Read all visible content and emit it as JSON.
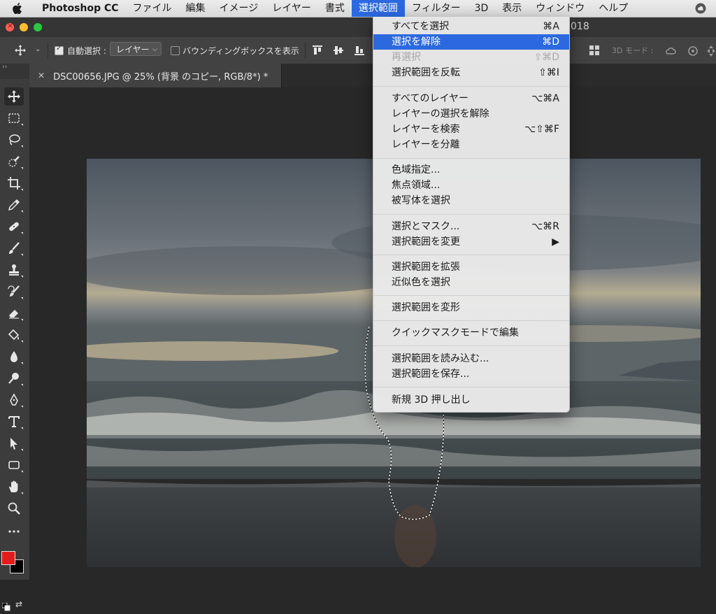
{
  "menubar": {
    "app_name": "Photoshop CC",
    "items": [
      "ファイル",
      "編集",
      "イメージ",
      "レイヤー",
      "書式",
      "選択範囲",
      "フィルター",
      "3D",
      "表示",
      "ウィンドウ",
      "ヘルプ"
    ],
    "active_index": 5
  },
  "window": {
    "title_fragment": "018"
  },
  "options_bar": {
    "auto_select_label": "自動選択 :",
    "auto_select_checked": true,
    "auto_select_target": "レイヤー",
    "show_bbox_label": "バウンディングボックスを表示",
    "show_bbox_checked": false,
    "mode_3d_label": "3D モード :"
  },
  "document_tab": {
    "title": "DSC00656.JPG @ 25% (背景 のコピー, RGB/8*) *"
  },
  "select_menu": {
    "groups": [
      [
        {
          "label": "すべてを選択",
          "shortcut": "⌘A"
        },
        {
          "label": "選択を解除",
          "shortcut": "⌘D",
          "highlighted": true
        },
        {
          "label": "再選択",
          "shortcut": "⇧⌘D",
          "disabled": true
        },
        {
          "label": "選択範囲を反転",
          "shortcut": "⇧⌘I"
        }
      ],
      [
        {
          "label": "すべてのレイヤー",
          "shortcut": "⌥⌘A"
        },
        {
          "label": "レイヤーの選択を解除",
          "shortcut": ""
        },
        {
          "label": "レイヤーを検索",
          "shortcut": "⌥⇧⌘F"
        },
        {
          "label": "レイヤーを分離",
          "shortcut": ""
        }
      ],
      [
        {
          "label": "色域指定...",
          "shortcut": ""
        },
        {
          "label": "焦点領域...",
          "shortcut": ""
        },
        {
          "label": "被写体を選択",
          "shortcut": ""
        }
      ],
      [
        {
          "label": "選択とマスク...",
          "shortcut": "⌥⌘R"
        },
        {
          "label": "選択範囲を変更",
          "shortcut": "▶"
        }
      ],
      [
        {
          "label": "選択範囲を拡張",
          "shortcut": ""
        },
        {
          "label": "近似色を選択",
          "shortcut": ""
        }
      ],
      [
        {
          "label": "選択範囲を変形",
          "shortcut": ""
        }
      ],
      [
        {
          "label": "クイックマスクモードで編集",
          "shortcut": ""
        }
      ],
      [
        {
          "label": "選択範囲を読み込む...",
          "shortcut": ""
        },
        {
          "label": "選択範囲を保存...",
          "shortcut": ""
        }
      ],
      [
        {
          "label": "新規 3D 押し出し",
          "shortcut": ""
        }
      ]
    ]
  },
  "tools": [
    "move-tool",
    "marquee-tool",
    "lasso-tool",
    "quick-selection-tool",
    "crop-tool",
    "eyedropper-tool",
    "healing-brush-tool",
    "brush-tool",
    "clone-stamp-tool",
    "history-brush-tool",
    "eraser-tool",
    "paint-bucket-tool",
    "blur-tool",
    "dodge-tool",
    "pen-tool",
    "type-tool",
    "path-selection-tool",
    "rectangle-tool",
    "hand-tool",
    "zoom-tool",
    "more-tools"
  ],
  "colors": {
    "foreground": "#e31b1b",
    "background": "#000000",
    "menu_highlight": "#2c69e0"
  }
}
